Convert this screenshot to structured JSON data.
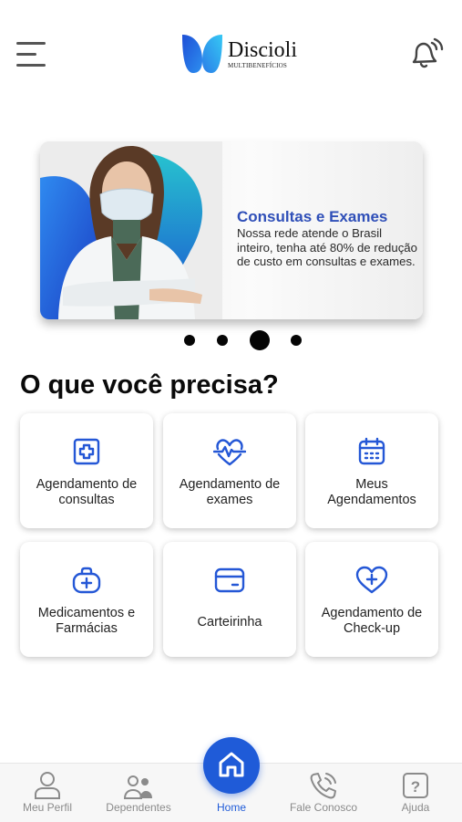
{
  "header": {
    "logo_name": "Discioli",
    "logo_sub": "MULTIBENEFÍCIOS"
  },
  "banner": {
    "title": "Consultas e Exames",
    "text": "Nossa rede atende o Brasil inteiro, tenha até 80% de redução de custo em consultas e exames.",
    "slide_count": 4,
    "active_slide": 3
  },
  "section": {
    "title": "O que você precisa?"
  },
  "services": [
    {
      "label": "Agendamento de consultas",
      "icon": "medical-cross-icon"
    },
    {
      "label": "Agendamento de exames",
      "icon": "heartbeat-icon"
    },
    {
      "label": "Meus Agendamentos",
      "icon": "calendar-icon"
    },
    {
      "label": "Medicamentos e Farmácias",
      "icon": "medical-bag-icon"
    },
    {
      "label": "Carteirinha",
      "icon": "card-icon"
    },
    {
      "label": "Agendamento de Check-up",
      "icon": "heart-plus-icon"
    }
  ],
  "nav": {
    "profile": "Meu Perfil",
    "dependents": "Dependentes",
    "home": "Home",
    "contact": "Fale Conosco",
    "help": "Ajuda"
  },
  "colors": {
    "primary": "#1f5bd8",
    "icon_blue": "#2457d6",
    "banner_title": "#2f4fb8",
    "nav_inactive": "#8b8b8b"
  }
}
